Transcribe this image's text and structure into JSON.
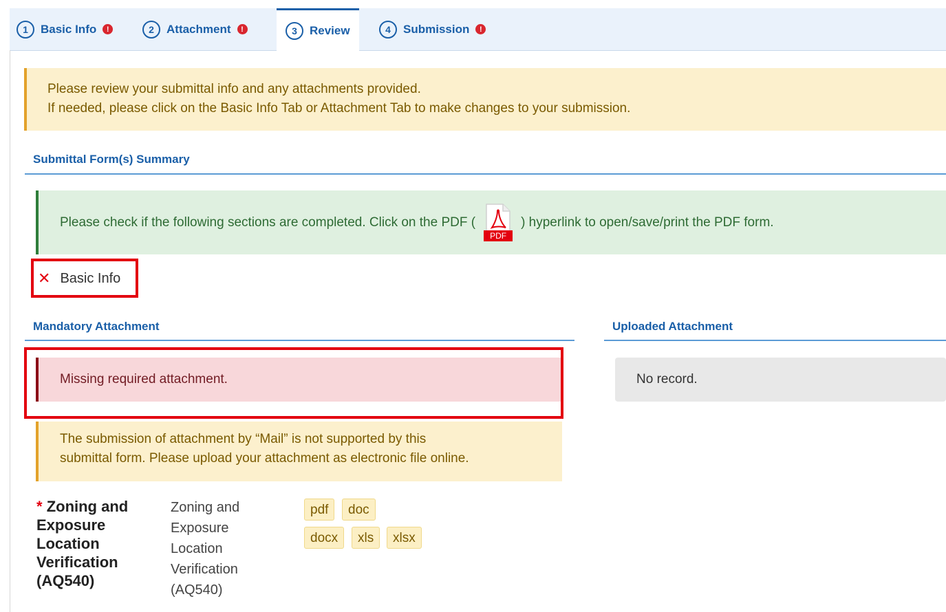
{
  "tabs": [
    {
      "num": "1",
      "label": "Basic Info",
      "alert": "!"
    },
    {
      "num": "2",
      "label": "Attachment",
      "alert": "!"
    },
    {
      "num": "3",
      "label": "Review",
      "alert": ""
    },
    {
      "num": "4",
      "label": "Submission",
      "alert": "!"
    }
  ],
  "review_note": {
    "line1": "Please review your submittal info and any attachments provided.",
    "line2": "If needed, please click on the Basic Info Tab or Attachment Tab to make changes to your submission."
  },
  "summary": {
    "title": "Submittal Form(s) Summary",
    "note_before": "Please check if the following sections are completed. Click on the PDF (",
    "pdf_label": "PDF",
    "note_after": ") hyperlink to open/save/print the PDF form.",
    "basic_info": {
      "mark": "✕",
      "label": "Basic Info"
    }
  },
  "mandatory": {
    "title": "Mandatory Attachment",
    "missing": "Missing required attachment.",
    "mail_note_line1": "The submission of attachment by “Mail” is not supported by this",
    "mail_note_line2": "submittal form. Please upload your attachment as electronic file online.",
    "item": {
      "star": "*",
      "name": "Zoning and Exposure Location Verification (AQ540)",
      "desc": "Zoning and Exposure Location Verification (AQ540)",
      "extensions": [
        "pdf",
        "doc",
        "docx",
        "xls",
        "xlsx"
      ]
    }
  },
  "uploaded": {
    "title": "Uploaded Attachment",
    "empty": "No record."
  },
  "colors": {
    "accent": "#1a5fa8",
    "error": "#e3000f",
    "warning_bg": "#fcf0cd",
    "success_bg": "#dff0e0"
  }
}
